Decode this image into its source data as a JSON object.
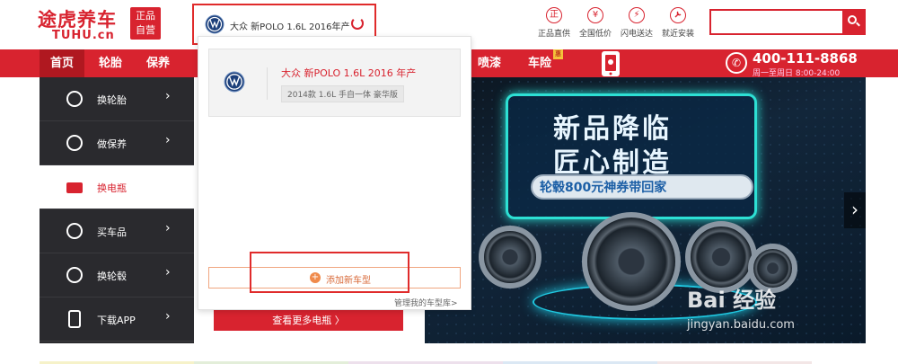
{
  "header": {
    "logo_main": "途虎养车",
    "logo_sub": "TUHU.cn",
    "logo_badge_line1": "正品",
    "logo_badge_line2": "自营",
    "car_selector_text": "大众 新POLO 1.6L 2016年产",
    "features": [
      {
        "icon": "正",
        "label": "正品直供",
        "icon_name": "authentic-icon"
      },
      {
        "icon": "¥",
        "label": "全国低价",
        "icon_name": "yen-icon"
      },
      {
        "icon": "⚡",
        "label": "闪电送达",
        "icon_name": "lightning-icon"
      },
      {
        "icon": "🔧",
        "label": "就近安装",
        "icon_name": "wrench-icon"
      }
    ],
    "search_placeholder": ""
  },
  "nav": {
    "items": [
      "首页",
      "轮胎",
      "保养",
      "喷漆",
      "车险"
    ],
    "phone_number": "400-111-8868",
    "phone_hours": "周一至周日  8:00-24:00",
    "promo_badge": "惠"
  },
  "sidebar": {
    "items": [
      {
        "label": "换轮胎",
        "icon": "tire-icon"
      },
      {
        "label": "做保养",
        "icon": "car-service-icon"
      },
      {
        "label": "换电瓶",
        "icon": "battery-icon"
      },
      {
        "label": "买车品",
        "icon": "toolbox-icon"
      },
      {
        "label": "换轮毂",
        "icon": "rim-icon"
      },
      {
        "label": "下载APP",
        "icon": "phone-icon"
      }
    ],
    "arrow": "›"
  },
  "dropdown": {
    "car_model": "大众 新POLO 1.6L 2016 年产",
    "car_trim": "2014款 1.6L 手自一体 豪华版",
    "add_car_label": "添加新车型",
    "manage_link": "管理我的车型库>"
  },
  "more_button": "查看更多电瓶 〉",
  "banner": {
    "headline_1": "新品降临",
    "headline_2": "匠心制造",
    "promo": "轮毂800元神券带回家",
    "next_arrow": "›",
    "watermark_1": "Bai 经验",
    "watermark_2": "jingyan.baidu.com"
  },
  "colors": {
    "brand_red": "#d8232f",
    "sidebar_dark": "#2a2a2e",
    "highlight_red": "#e02b2b",
    "banner_cyan": "#2de0d4"
  }
}
